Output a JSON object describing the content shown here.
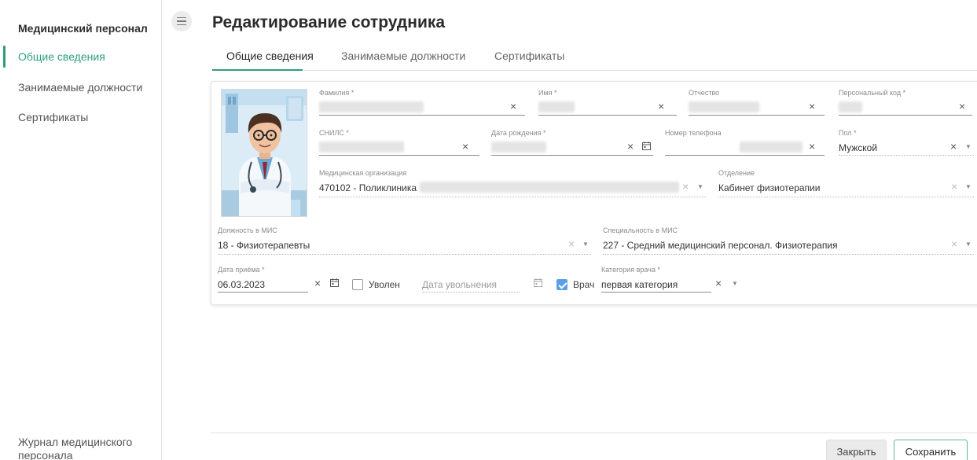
{
  "sidebar": {
    "title": "Медицинский персонал",
    "items": [
      {
        "label": "Общие сведения",
        "active": true
      },
      {
        "label": "Занимаемые должности",
        "active": false
      },
      {
        "label": "Сертификаты",
        "active": false
      }
    ],
    "bottom_link": "Журнал медицинского персонала"
  },
  "header": {
    "title": "Редактирование сотрудника"
  },
  "tabs": [
    {
      "label": "Общие сведения",
      "active": true
    },
    {
      "label": "Занимаемые должности",
      "active": false
    },
    {
      "label": "Сертификаты",
      "active": false
    }
  ],
  "form": {
    "last_name": {
      "label": "Фамилия *",
      "value": ""
    },
    "first_name": {
      "label": "Имя *",
      "value": ""
    },
    "patronymic": {
      "label": "Отчество",
      "value": ""
    },
    "personal_code": {
      "label": "Персональный код *",
      "value": ""
    },
    "snils": {
      "label": "СНИЛС *",
      "value": ""
    },
    "birth_date": {
      "label": "Дата рождения *",
      "value": ""
    },
    "phone": {
      "label": "Номер телефона",
      "value": ""
    },
    "gender": {
      "label": "Пол *",
      "value": "Мужской"
    },
    "med_org": {
      "label": "Медицинская организация",
      "value": "470102 - Поликлиника"
    },
    "department": {
      "label": "Отделение",
      "value": "Кабинет физиотерапии"
    },
    "position_mis": {
      "label": "Должность в МИС",
      "value": "18 - Физиотерапевты"
    },
    "specialty_mis": {
      "label": "Специальность в МИС",
      "value": "227 - Средний медицинский персонал. Физиотерапия"
    },
    "hire_date": {
      "label": "Дата приёма *",
      "value": "06.03.2023"
    },
    "dismissed": {
      "label": "Уволен",
      "checked": false
    },
    "dismissal_date": {
      "placeholder": "Дата увольнения"
    },
    "doctor": {
      "label": "Врач",
      "checked": true
    },
    "doctor_category": {
      "label": "Категория врача *",
      "value": "первая категория"
    }
  },
  "footer": {
    "close_label": "Закрыть",
    "save_label": "Сохранить"
  },
  "colors": {
    "accent": "#2e9e7e",
    "checkbox": "#5aa0e6"
  },
  "icons": {
    "clear": "×",
    "dropdown": "▼"
  }
}
